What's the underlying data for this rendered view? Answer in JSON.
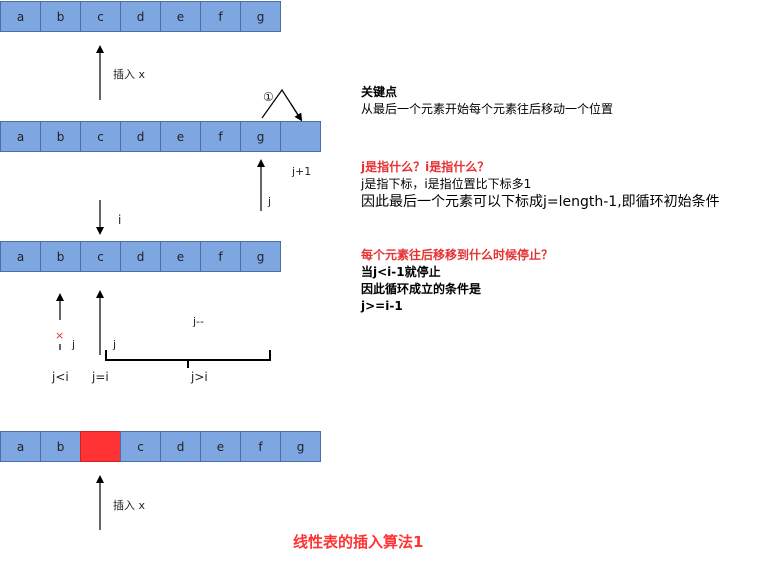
{
  "arrays": {
    "row1": [
      "a",
      "b",
      "c",
      "d",
      "e",
      "f",
      "g"
    ],
    "row2": [
      "a",
      "b",
      "c",
      "d",
      "e",
      "f",
      "g",
      ""
    ],
    "row3": [
      "a",
      "b",
      "c",
      "d",
      "e",
      "f",
      "g"
    ],
    "row4": [
      "a",
      "b",
      "",
      "c",
      "d",
      "e",
      "f",
      "g"
    ]
  },
  "labels": {
    "insert_x_top": "插入 x",
    "insert_x_bottom": "插入 x",
    "circle_one": "①",
    "j_plus_1": "j+1",
    "j_row2": "j",
    "i_label": "i",
    "j_decrement": "j--",
    "cross": "×",
    "j_small": "j",
    "j_at_c": "j",
    "j_lt_i": "j<i",
    "j_eq_i": "j=i",
    "j_gt_i": "j>i"
  },
  "notes": {
    "key_title": "关键点",
    "key_desc": "从最后一个元素开始每个元素往后移动一个位置",
    "q1": "j是指什么？i是指什么？",
    "a1": "j是指下标，i是指位置比下标多1",
    "a1_big": "因此最后一个元素可以下标成j=length-1,即循环初始条件",
    "q2": "每个元素往后移移到什么时候停止？",
    "a2_line1": "当j<i-1就停止",
    "a2_line2": "因此循环成立的条件是",
    "a2_line3": "j>=i-1"
  },
  "title": "线性表的插入算法1",
  "colors": {
    "cell_fill": "#7ea6e0",
    "cell_stroke": "#4a6fa5",
    "highlight_fill": "#ff3333",
    "accent_red": "#e53333"
  }
}
